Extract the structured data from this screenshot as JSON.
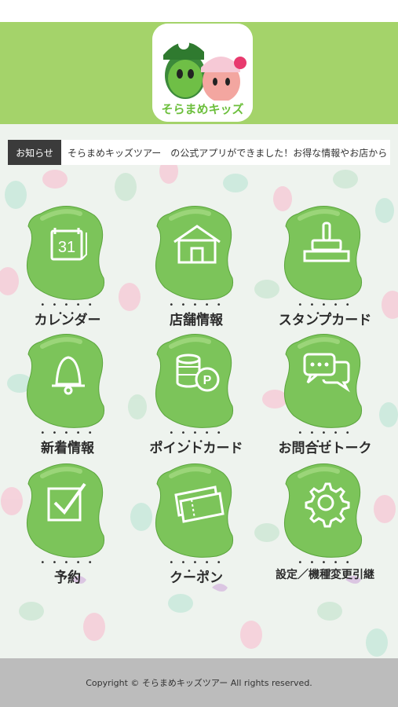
{
  "header": {
    "app_logo_text": "そらまめキッズ"
  },
  "news": {
    "label": "お知らせ",
    "text": "そらまめキッズツアー　の公式アプリができました！お得な情報やお店から"
  },
  "menu": [
    {
      "label": "カレンダー",
      "icon": "calendar-icon",
      "calendar_day": "31"
    },
    {
      "label": "店舗情報",
      "icon": "house-icon"
    },
    {
      "label": "スタンプカード",
      "icon": "stamp-icon"
    },
    {
      "label": "新着情報",
      "icon": "bell-icon"
    },
    {
      "label": "ポイントカード",
      "icon": "coins-icon",
      "badge": "P"
    },
    {
      "label": "お問合せトーク",
      "icon": "chat-bubbles-icon"
    },
    {
      "label": "予約",
      "icon": "checkbox-icon"
    },
    {
      "label": "クーポン",
      "icon": "coupon-icon"
    },
    {
      "label": "設定／機種変更引継",
      "icon": "gear-icon"
    }
  ],
  "footer": {
    "copyright": "Copyright © そらまめキッズツアー All rights reserved."
  },
  "colors": {
    "header_green": "#a4d36a",
    "bean_green": "#7cc45a",
    "footer_gray": "#bcbcbc"
  }
}
